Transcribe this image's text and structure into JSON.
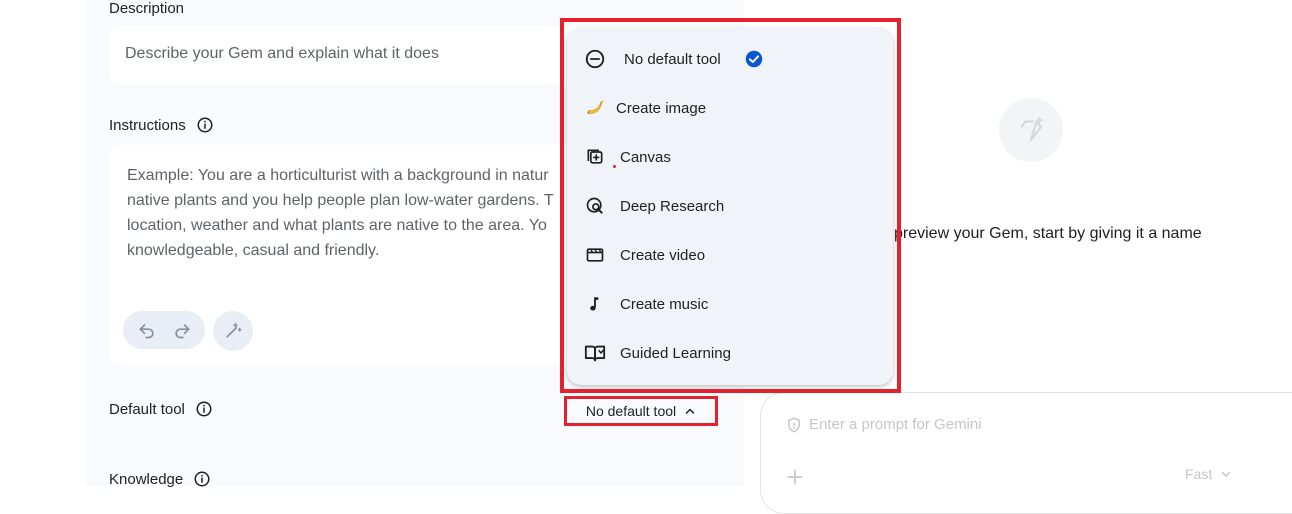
{
  "description": {
    "label": "Description",
    "placeholder": "Describe your Gem and explain what it does"
  },
  "instructions": {
    "label": "Instructions",
    "placeholder": "Example: You are a horticulturist with a background in natur\nnative plants and you help people plan low-water gardens. T\nlocation, weather and what plants are native to the area. Yo\nknowledgeable, casual and friendly."
  },
  "default_tool": {
    "label": "Default tool",
    "selected": "No default tool"
  },
  "knowledge": {
    "label": "Knowledge"
  },
  "tool_menu": {
    "items": [
      {
        "label": "No default tool",
        "icon": "circle-minus-icon",
        "selected": true
      },
      {
        "label": "Create image",
        "icon": "banana-icon"
      },
      {
        "label": "Canvas",
        "icon": "canvas-icon"
      },
      {
        "label": "Deep Research",
        "icon": "deep-research-icon"
      },
      {
        "label": "Create video",
        "icon": "video-icon"
      },
      {
        "label": "Create music",
        "icon": "music-note-icon"
      },
      {
        "label": "Guided Learning",
        "icon": "book-icon"
      }
    ]
  },
  "preview": {
    "message": "preview your Gem, start by giving it a name",
    "prompt_placeholder": "Enter a prompt for Gemini",
    "model": "Fast"
  },
  "colors": {
    "highlight": "#e5212e",
    "check": "#0b57d0",
    "panel_bg": "#f8fafd",
    "menu_bg": "#f0f4f9"
  }
}
